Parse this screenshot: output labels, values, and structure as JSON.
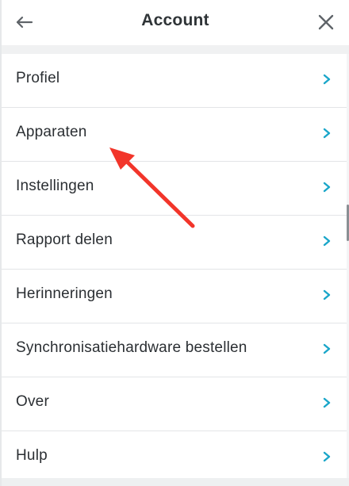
{
  "header": {
    "title": "Account",
    "back_icon": "arrow-left-icon",
    "close_icon": "close-icon"
  },
  "menu": {
    "items": [
      {
        "label": "Profiel",
        "icon": "chevron-right-icon"
      },
      {
        "label": "Apparaten",
        "icon": "chevron-right-icon"
      },
      {
        "label": "Instellingen",
        "icon": "chevron-right-icon"
      },
      {
        "label": "Rapport delen",
        "icon": "chevron-right-icon"
      },
      {
        "label": "Herinneringen",
        "icon": "chevron-right-icon"
      },
      {
        "label": "Synchronisatiehardware bestellen",
        "icon": "chevron-right-icon"
      },
      {
        "label": "Over",
        "icon": "chevron-right-icon"
      },
      {
        "label": "Hulp",
        "icon": "chevron-right-icon"
      }
    ]
  },
  "colors": {
    "accent_chevron": "#1aa6c9",
    "annotation_arrow": "#f2352a",
    "text_primary": "#2b2f33",
    "background": "#f4f5f6"
  }
}
